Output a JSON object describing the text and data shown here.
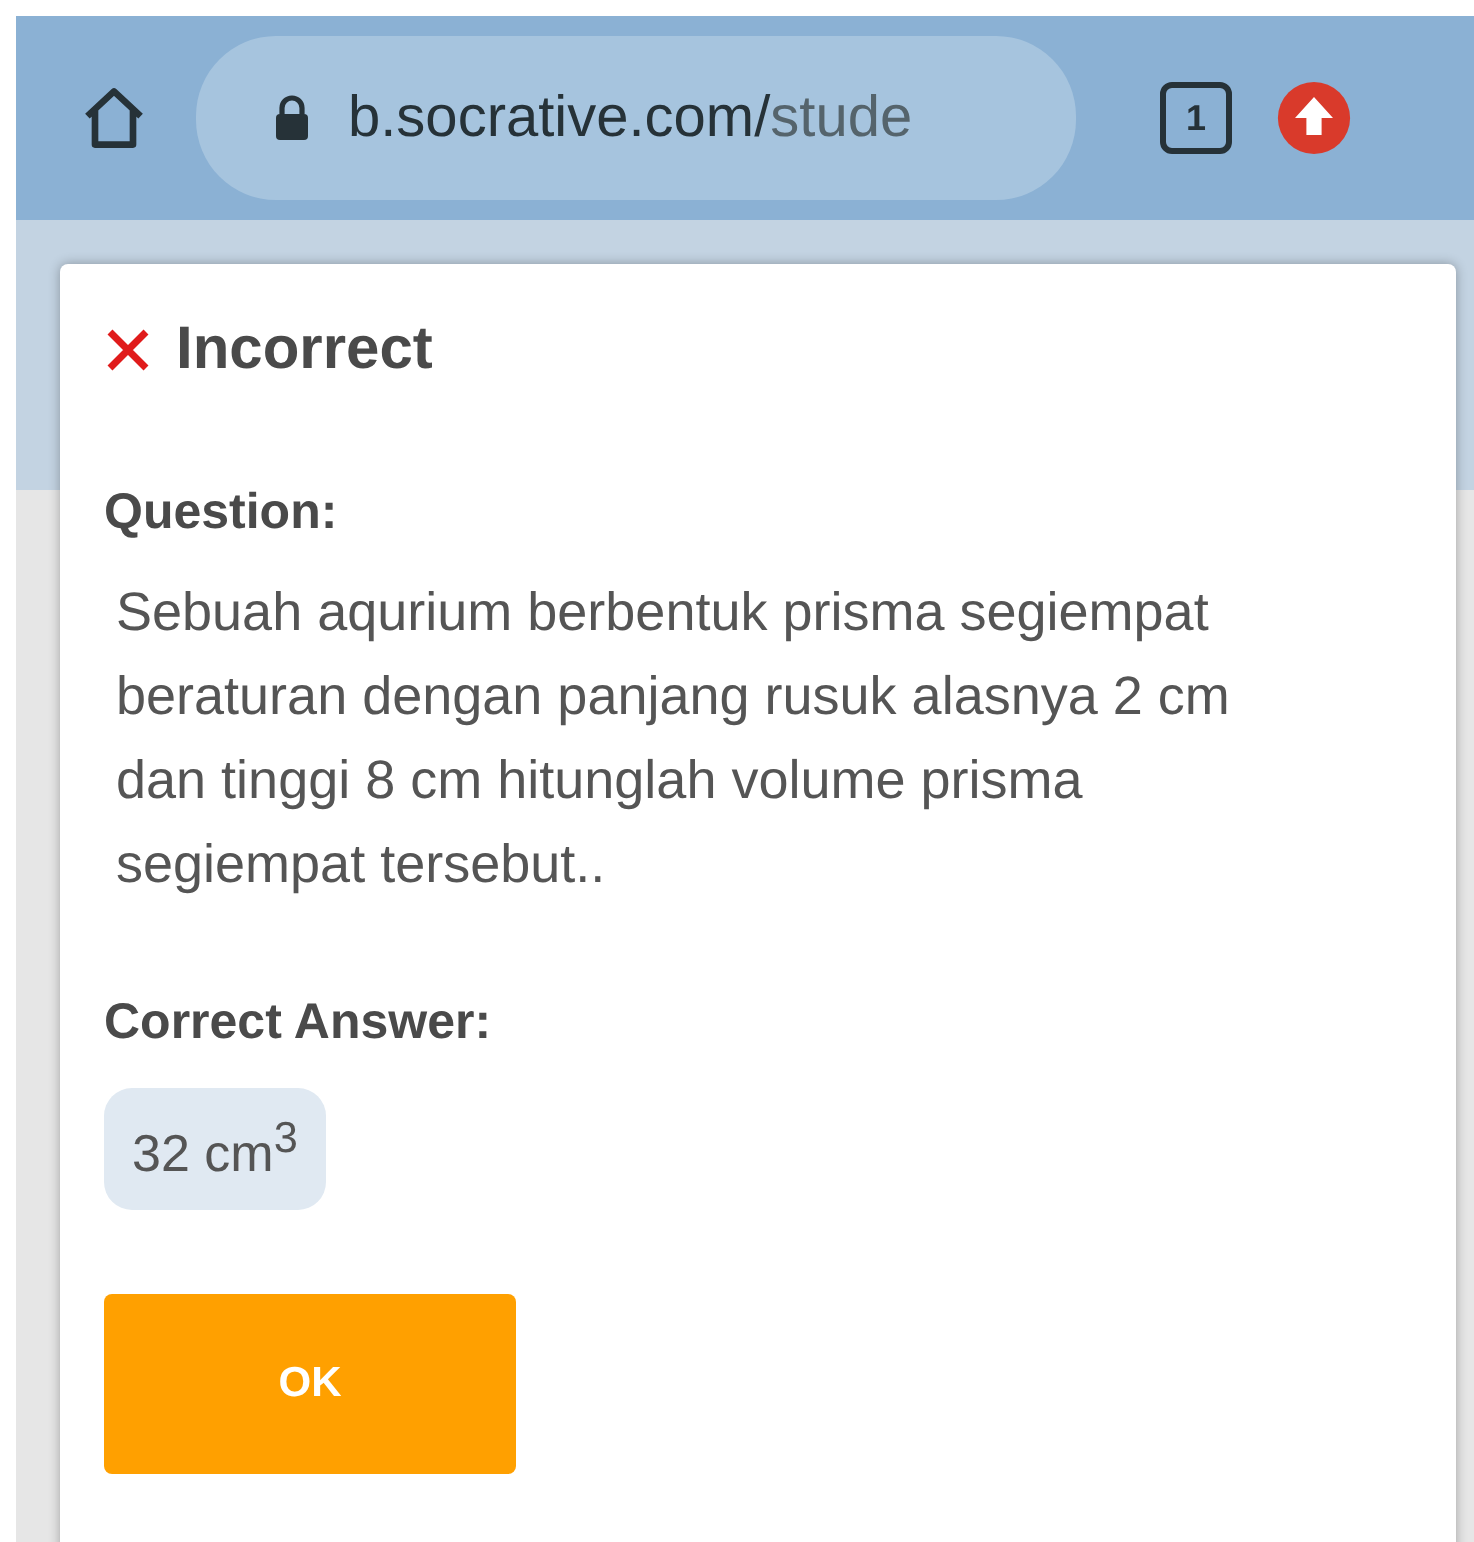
{
  "browser": {
    "url_host": "b.socrative.com/",
    "url_path": "stude",
    "tab_count": "1"
  },
  "result": {
    "correct": false,
    "title": "Incorrect"
  },
  "question": {
    "label": "Question:",
    "text": "Sebuah aqurium berbentuk prisma segiempat beraturan dengan panjang rusuk alasnya 2 cm dan tinggi 8 cm hitunglah volume prisma segiempat tersebut.."
  },
  "answer": {
    "label": "Correct Answer:",
    "value": "32 cm$^{3}$"
  },
  "buttons": [
    "OK"
  ]
}
